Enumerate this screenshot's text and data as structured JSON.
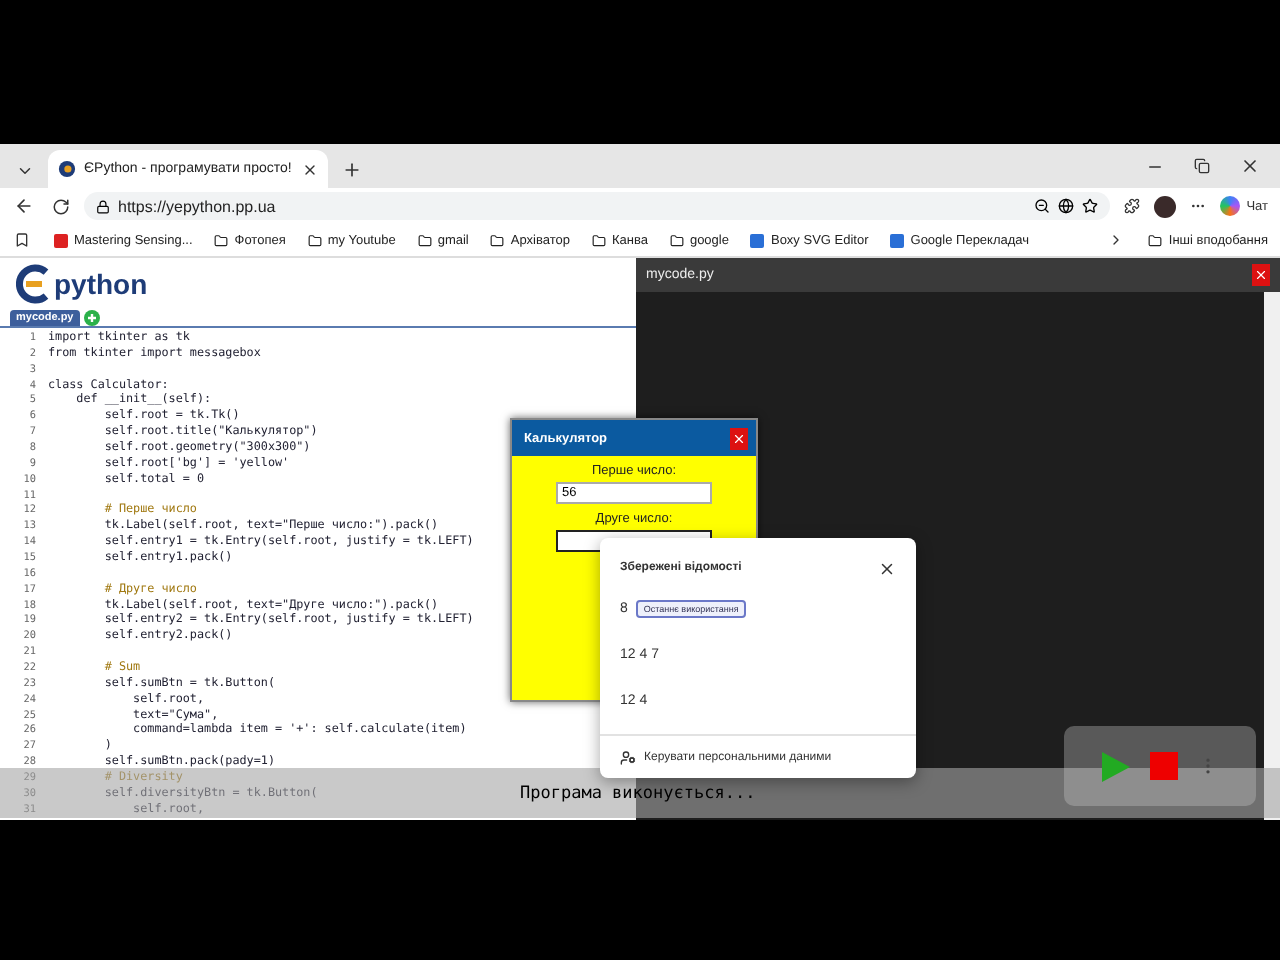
{
  "browser": {
    "tab": {
      "title": "ЄPython - програмувати просто!",
      "selected": true
    },
    "url": "https://yepython.pp.ua",
    "chat_label": "Чат",
    "bookmarks": [
      {
        "kind": "site",
        "label": "Mastering Sensing..."
      },
      {
        "kind": "folder",
        "label": "Фотопея"
      },
      {
        "kind": "folder",
        "label": "my Youtube"
      },
      {
        "kind": "folder",
        "label": "gmail"
      },
      {
        "kind": "folder",
        "label": "Архіватор"
      },
      {
        "kind": "folder",
        "label": "Канва"
      },
      {
        "kind": "folder",
        "label": "google"
      },
      {
        "kind": "site",
        "label": "Boxy SVG Editor"
      },
      {
        "kind": "site",
        "label": "Google Перекладач"
      }
    ],
    "other_bookmarks": "Інші вподобання"
  },
  "editor": {
    "logo_text": "python",
    "file_tabs": [
      {
        "label": "mycode.py",
        "selected": true
      }
    ],
    "lines": [
      {
        "number": "1",
        "kind": "code",
        "text": "import tkinter as tk"
      },
      {
        "number": "2",
        "kind": "code",
        "text": "from tkinter import messagebox"
      },
      {
        "number": "3",
        "kind": "blank"
      },
      {
        "number": "4",
        "kind": "code",
        "text": "class Calculator:"
      },
      {
        "number": "5",
        "kind": "code",
        "text": "    def __init__(self):"
      },
      {
        "number": "6",
        "kind": "code",
        "text": "        self.root = tk.Tk()"
      },
      {
        "number": "7",
        "kind": "code",
        "text": "        self.root.title(\"Калькулятор\")"
      },
      {
        "number": "8",
        "kind": "code",
        "text": "        self.root.geometry(\"300x300\")"
      },
      {
        "number": "9",
        "kind": "code",
        "text": "        self.root['bg'] = 'yellow'"
      },
      {
        "number": "10",
        "kind": "code",
        "text": "        self.total = 0"
      },
      {
        "number": "11",
        "kind": "blank"
      },
      {
        "number": "12",
        "kind": "comment",
        "text": "        # Перше число"
      },
      {
        "number": "13",
        "kind": "code",
        "text": "        tk.Label(self.root, text=\"Перше число:\").pack()"
      },
      {
        "number": "14",
        "kind": "code",
        "text": "        self.entry1 = tk.Entry(self.root, justify = tk.LEFT)"
      },
      {
        "number": "15",
        "kind": "code",
        "text": "        self.entry1.pack()"
      },
      {
        "number": "16",
        "kind": "blank"
      },
      {
        "number": "17",
        "kind": "comment",
        "text": "        # Друге число"
      },
      {
        "number": "18",
        "kind": "code",
        "text": "        tk.Label(self.root, text=\"Друге число:\").pack()"
      },
      {
        "number": "19",
        "kind": "code",
        "text": "        self.entry2 = tk.Entry(self.root, justify = tk.LEFT)"
      },
      {
        "number": "20",
        "kind": "code",
        "text": "        self.entry2.pack()"
      },
      {
        "number": "21",
        "kind": "blank"
      },
      {
        "number": "22",
        "kind": "comment",
        "text": "        # Sum"
      },
      {
        "number": "23",
        "kind": "code",
        "text": "        self.sumBtn = tk.Button("
      },
      {
        "number": "24",
        "kind": "code",
        "text": "            self.root,"
      },
      {
        "number": "25",
        "kind": "code",
        "text": "            text=\"Сума\","
      },
      {
        "number": "26",
        "kind": "code",
        "text": "            command=lambda item = '+': self.calculate(item)"
      },
      {
        "number": "27",
        "kind": "code",
        "text": "        )"
      },
      {
        "number": "28",
        "kind": "code",
        "text": "        self.sumBtn.pack(pady=1)"
      },
      {
        "number": "29",
        "kind": "comment",
        "text": "        # Diversity"
      },
      {
        "number": "30",
        "kind": "code",
        "text": "        self.diversityBtn = tk.Button("
      },
      {
        "number": "31",
        "kind": "code",
        "text": "            self.root,"
      }
    ]
  },
  "console": {
    "title": "mycode.py",
    "status": "Програма виконується..."
  },
  "calculator": {
    "title": "Калькулятор",
    "label_1": "Перше число:",
    "value_1": "56",
    "label_2": "Друге число:",
    "field_2_focused": true
  },
  "autofill": {
    "title": "Збережені відомості",
    "items": [
      {
        "value": "8",
        "badge": "Останнє використання"
      },
      {
        "value": "12 4 7"
      },
      {
        "value": "12 4"
      }
    ],
    "footer": "Керувати персональними даними"
  }
}
